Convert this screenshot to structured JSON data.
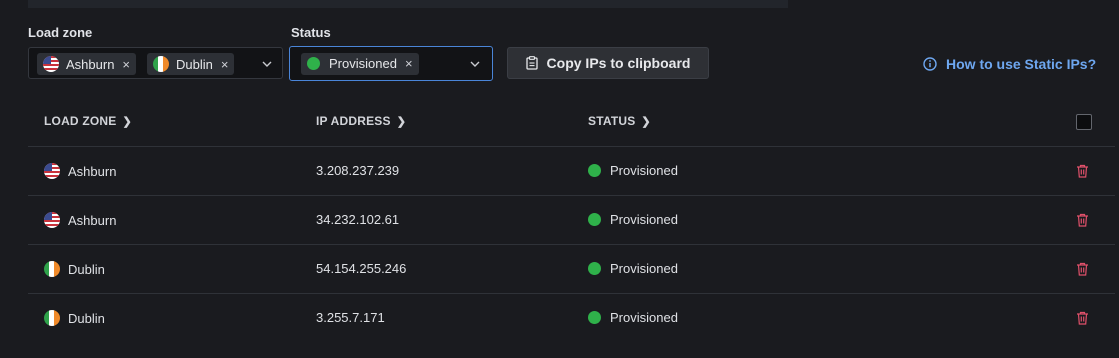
{
  "filters": {
    "load_zone_label": "Load zone",
    "status_label": "Status",
    "load_zone_chips": [
      {
        "label": "Ashburn",
        "flag": "us-flag-icon"
      },
      {
        "label": "Dublin",
        "flag": "ireland-flag-icon"
      }
    ],
    "status_chips": [
      {
        "label": "Provisioned",
        "color": "#2fb14a"
      }
    ],
    "remove_glyph": "×"
  },
  "toolbar": {
    "copy_label": "Copy IPs to clipboard",
    "help_label": "How to use Static IPs?"
  },
  "table": {
    "headers": [
      "LOAD ZONE",
      "IP ADDRESS",
      "STATUS"
    ],
    "rows": [
      {
        "zone": "Ashburn",
        "flag": "us-flag-icon",
        "ip": "3.208.237.239",
        "status": "Provisioned"
      },
      {
        "zone": "Ashburn",
        "flag": "us-flag-icon",
        "ip": "34.232.102.61",
        "status": "Provisioned"
      },
      {
        "zone": "Dublin",
        "flag": "ireland-flag-icon",
        "ip": "54.154.255.246",
        "status": "Provisioned"
      },
      {
        "zone": "Dublin",
        "flag": "ireland-flag-icon",
        "ip": "3.255.7.171",
        "status": "Provisioned"
      }
    ]
  },
  "colors": {
    "background": "#1a1b1f",
    "accent": "#6ea7f0",
    "focus_border": "#4a85d8",
    "status_green": "#2fb14a",
    "delete_red": "#e0506a"
  }
}
